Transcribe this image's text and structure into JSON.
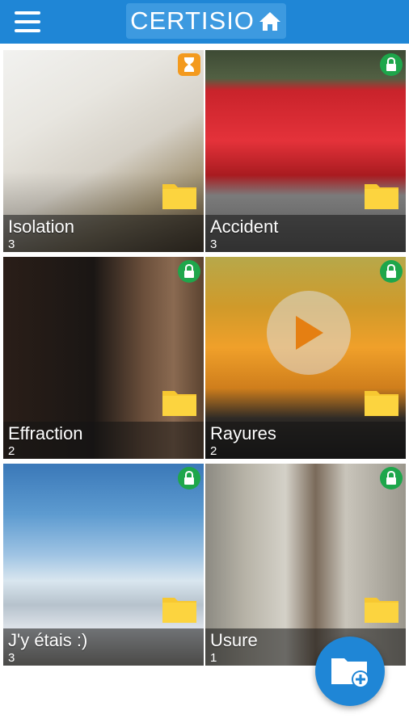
{
  "app": {
    "brand": "CERTISIO"
  },
  "icons": {
    "menu": "menu-icon",
    "home": "home-icon",
    "folder": "folder-icon",
    "lock": "lock-icon",
    "hourglass": "hourglass-icon",
    "play": "play-icon",
    "add_folder": "add-folder-icon"
  },
  "colors": {
    "primary": "#1f86d6",
    "lock_badge": "#1ea64b",
    "pending_badge": "#f39a1e",
    "folder": "#f7c831"
  },
  "albums": [
    {
      "title": "Isolation",
      "count": "3",
      "status": "pending"
    },
    {
      "title": "Accident",
      "count": "3",
      "status": "locked"
    },
    {
      "title": "Effraction",
      "count": "2",
      "status": "locked"
    },
    {
      "title": "Rayures",
      "count": "2",
      "status": "locked",
      "video": true
    },
    {
      "title": "J'y étais :)",
      "count": "3",
      "status": "locked"
    },
    {
      "title": "Usure",
      "count": "1",
      "status": "locked"
    }
  ]
}
